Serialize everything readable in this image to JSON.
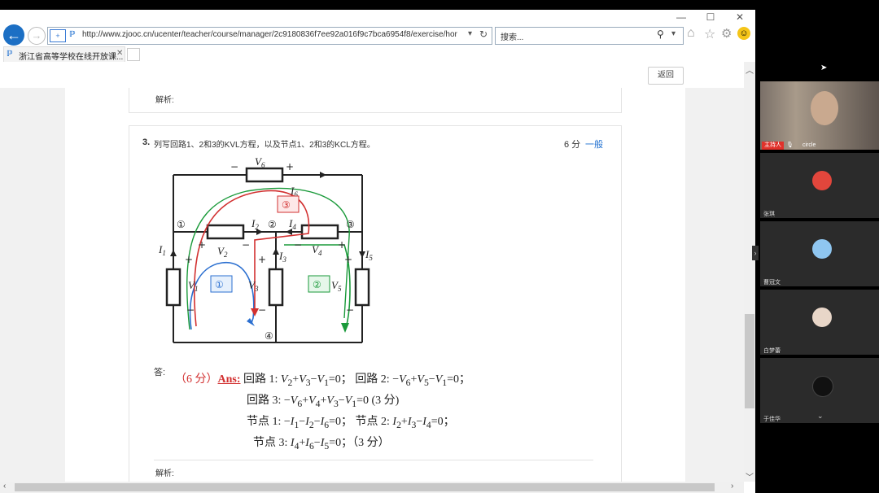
{
  "browser": {
    "address": "http://www.zjooc.cn/ucenter/teacher/course/manager/2c9180836f7ee92a016f9c7bca6954f8/exercise/hor",
    "search_placeholder": "搜索...",
    "tab_title": "浙江省高等学校在线开放课..."
  },
  "toolbar": {
    "return_label": "返回"
  },
  "prev_card": {
    "analysis_label": "解析:"
  },
  "question": {
    "number": "3.",
    "text": "列写回路1、2和3的KVL方程，以及节点1、2和3的KCL方程。",
    "score": "6 分",
    "difficulty": "一般",
    "answer_label": "答:",
    "analysis_label": "解析:"
  },
  "answer": {
    "score_tag": "（6 分）",
    "ans_tag": "Ans:",
    "loop1_label": "回路 1:",
    "loop2_label": "回路 2:",
    "loop3_label": "回路 3:",
    "node1_label": "节点 1:",
    "node2_label": "节点 2:",
    "node3_label": "节点 3:",
    "part_score": "(3 分)",
    "part_score2": "（3 分）"
  },
  "circuit": {
    "nodes": [
      "①",
      "②",
      "③",
      "④"
    ],
    "loops": [
      "①",
      "②",
      "③"
    ]
  },
  "meeting": {
    "host_tag": "主持人",
    "host_name": "circle",
    "participants": [
      "张琪",
      "曹冠文",
      "白梦蕾",
      "于佳华"
    ]
  }
}
